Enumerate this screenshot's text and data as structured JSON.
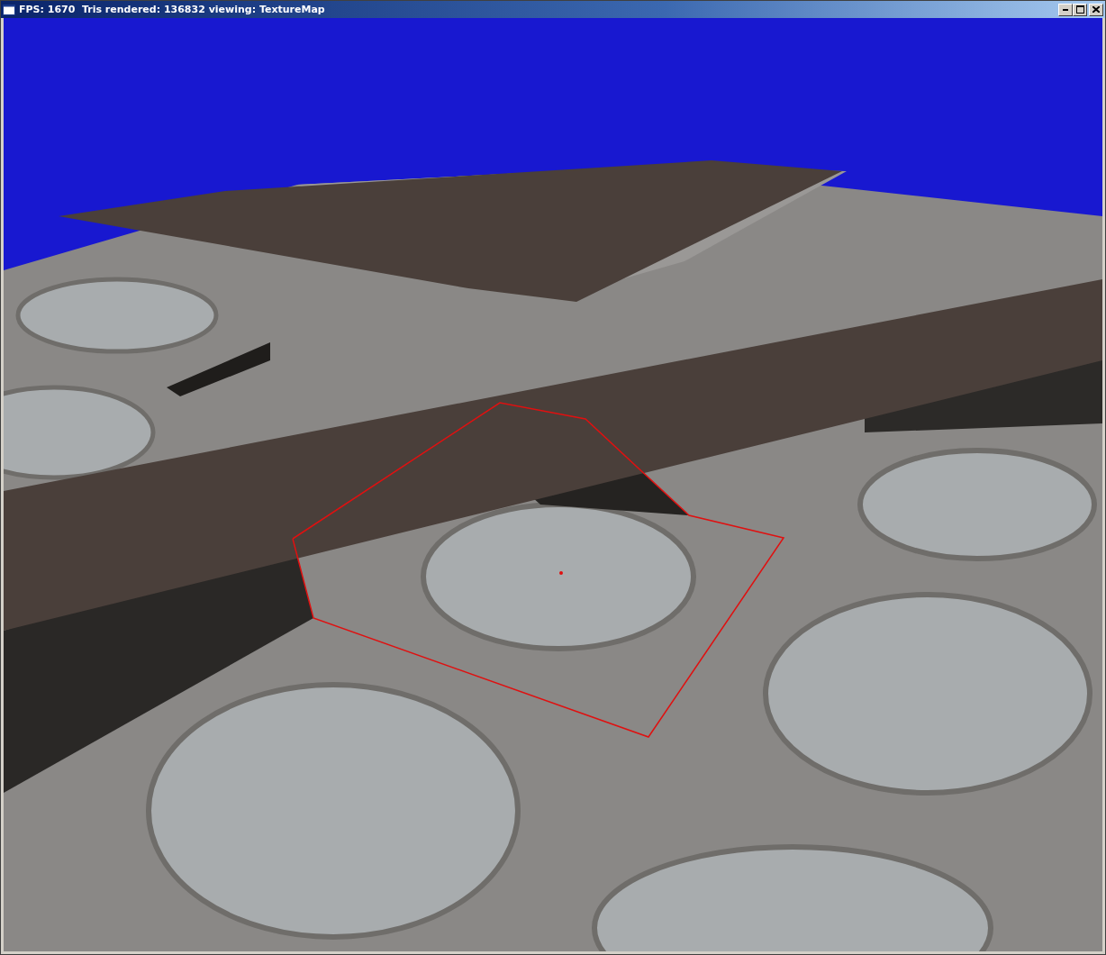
{
  "window": {
    "title": "FPS: 1670  Tris rendered: 136832 viewing: TextureMap"
  }
}
